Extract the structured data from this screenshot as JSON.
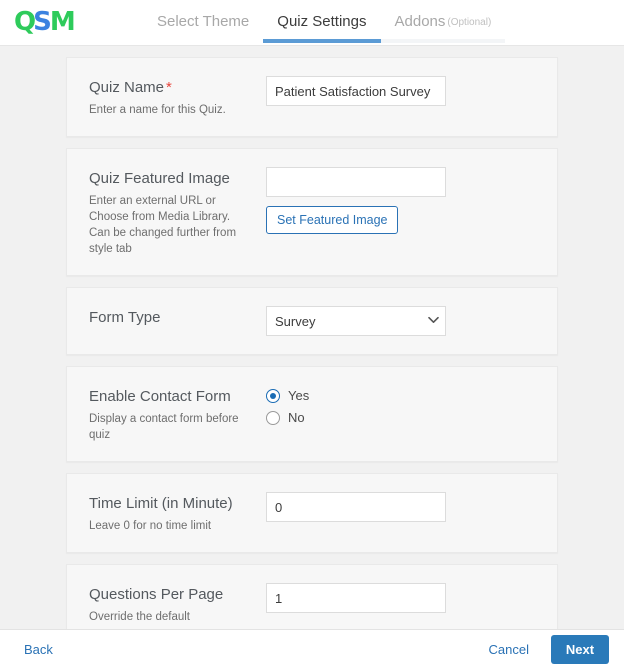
{
  "header": {
    "logo_text": "QSM",
    "logo_letters": {
      "q": "Q",
      "s": "S",
      "m": "M"
    },
    "logo_colors": {
      "green": "#2ecb5b",
      "blue": "#3b82e0"
    },
    "tabs": [
      {
        "label": "Select Theme",
        "state": "done"
      },
      {
        "label": "Quiz Settings",
        "state": "active"
      },
      {
        "label": "Addons",
        "suffix": "(Optional)",
        "state": "upcoming"
      }
    ],
    "active_tab_color": "#5b9bd5"
  },
  "form": {
    "fields": [
      {
        "label": "Quiz Name",
        "required": true,
        "description": "Enter a name for this Quiz.",
        "control": "text",
        "value": "Patient Satisfaction Survey",
        "placeholder": ""
      },
      {
        "label": "Quiz Featured Image",
        "required": false,
        "description": "Enter an external URL or Choose from Media Library. Can be changed further from style tab",
        "control": "text-with-button",
        "value": "",
        "placeholder": "",
        "button_label": "Set Featured Image"
      },
      {
        "label": "Form Type",
        "required": false,
        "description": "",
        "control": "select",
        "value": "Survey",
        "options": [
          "Survey"
        ]
      },
      {
        "label": "Enable Contact Form",
        "required": false,
        "description": "Display a contact form before quiz",
        "control": "radio",
        "value": "Yes",
        "options": [
          "Yes",
          "No"
        ]
      },
      {
        "label": "Time Limit (in Minute)",
        "required": false,
        "description": "Leave 0 for no time limit",
        "control": "text",
        "value": "0",
        "placeholder": ""
      },
      {
        "label": "Questions Per Page",
        "required": false,
        "description": "Override the default",
        "control": "text",
        "value": "1",
        "placeholder": ""
      }
    ]
  },
  "footer": {
    "back_label": "Back",
    "cancel_label": "Cancel",
    "next_label": "Next",
    "link_color": "#2a72b5",
    "next_button_color": "#2a7ab9"
  }
}
